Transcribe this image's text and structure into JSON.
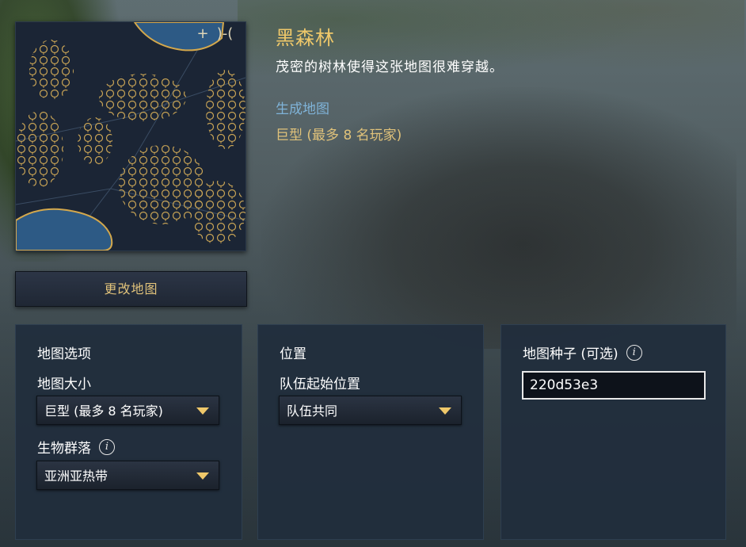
{
  "map": {
    "title": "黑森林",
    "description": "茂密的树林使得这张地图很难穿越。",
    "generate_link": "生成地图",
    "size_info": "巨型 (最多 8 名玩家)",
    "change_button": "更改地图",
    "preview_buttons": {
      "zoom": "+",
      "symbol": ")-("
    }
  },
  "panels": {
    "map_options": {
      "title": "地图选项",
      "size_label": "地图大小",
      "size_value": "巨型 (最多 8 名玩家)",
      "biome_label": "生物群落",
      "biome_value": "亚洲亚热带"
    },
    "position": {
      "title": "位置",
      "team_start_label": "队伍起始位置",
      "team_start_value": "队伍共同"
    },
    "seed": {
      "label": "地图种子 (可选)",
      "value": "220d53e3"
    }
  },
  "colors": {
    "gold_accent": "#efc86a",
    "link_blue": "#7fb3d8",
    "panel_bg": "#212e3d"
  },
  "icons": {
    "info": "i",
    "dropdown": "chevron-down"
  }
}
